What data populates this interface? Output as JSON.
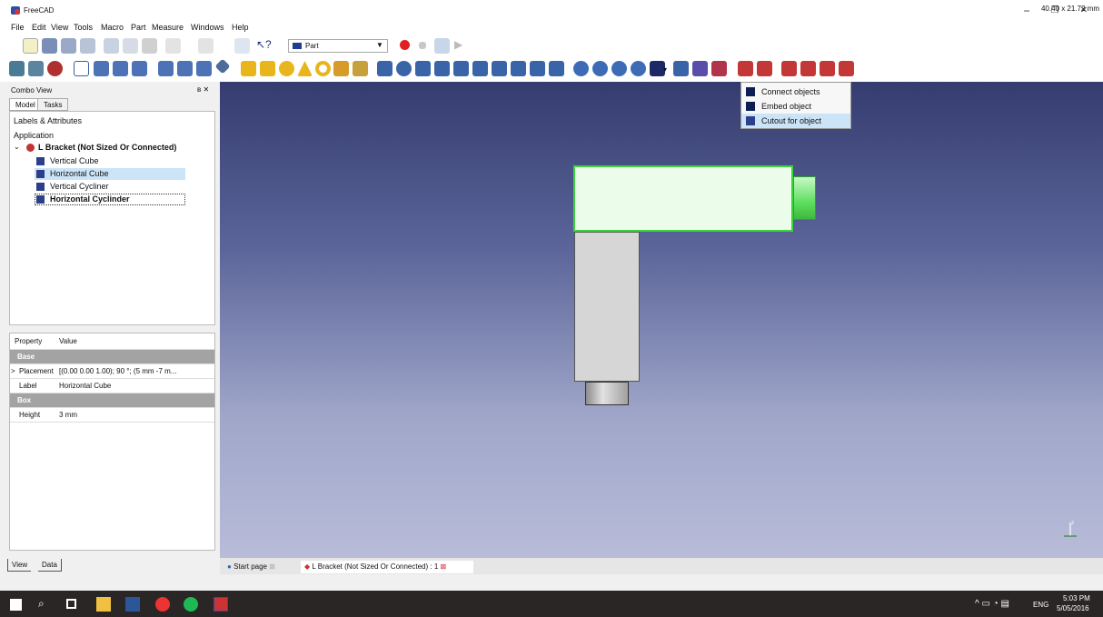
{
  "app": {
    "title": "FreeCAD"
  },
  "window_controls": {
    "minimize": "−",
    "maximize": "❐",
    "close": "✕"
  },
  "menu": [
    "File",
    "Edit",
    "View",
    "Tools",
    "Macro",
    "Part",
    "Measure",
    "Windows",
    "Help"
  ],
  "workbench": {
    "selected": "Part"
  },
  "combo": {
    "title": "Combo View",
    "tabs": [
      "Model",
      "Tasks"
    ],
    "tree": {
      "header": "Labels & Attributes",
      "section": "Application",
      "root": "L Bracket (Not Sized Or Connected)",
      "items": [
        "Vertical Cube",
        "Horizontal Cube",
        "Vertical Cycliner",
        "Horizontal Cyclinder"
      ]
    },
    "properties": {
      "col_property": "Property",
      "col_value": "Value",
      "rows": [
        {
          "group": "Base"
        },
        {
          "name": "Placement",
          "value": "[(0.00 0.00 1.00); 90 °; (5 mm  -7 m..."
        },
        {
          "name": "Label",
          "value": "Horizontal Cube"
        },
        {
          "group": "Box"
        },
        {
          "name": "Height",
          "value": "3 mm"
        }
      ]
    },
    "bottom_tabs": [
      "View",
      "Data"
    ]
  },
  "dropdown": {
    "items": [
      "Connect objects",
      "Embed object",
      "Cutout for object"
    ],
    "highlighted": "Cutout for object"
  },
  "doc_tabs": [
    "Start page",
    "L Bracket (Not Sized Or Connected) : 1"
  ],
  "status": {
    "dimensions": "40.40 x 21.72 mm"
  },
  "taskbar": {
    "language": "ENG",
    "time": "5:03 PM",
    "date": "5/05/2016"
  },
  "colors": {
    "viewport_top": "#353c6f",
    "viewport_bottom": "#b8bcd9",
    "selection_green": "#3ed23e",
    "dropdown_highlight": "#cce4f7"
  }
}
